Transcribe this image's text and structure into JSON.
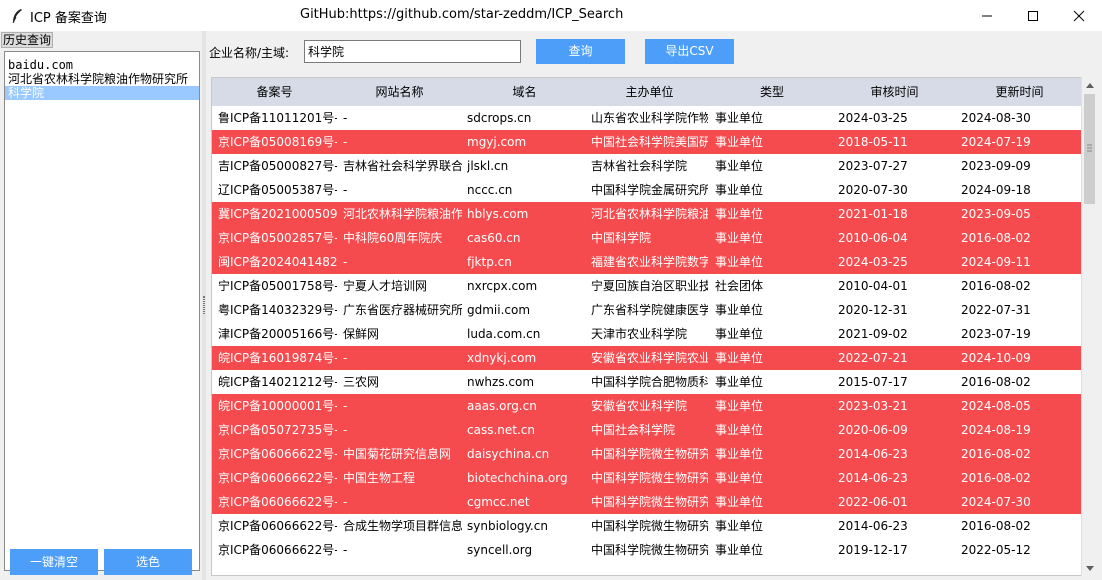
{
  "window": {
    "title": "ICP 备案查询",
    "center_text": "GitHub:https://github.com/star-zeddm/ICP_Search"
  },
  "history": {
    "label": "历史查询",
    "items": [
      "baidu.com",
      "河北省农林科学院粮油作物研究所",
      "科学院"
    ],
    "selected_index": 2,
    "clear_button": "一键清空",
    "color_button": "选色"
  },
  "search": {
    "label": "企业名称/主域:",
    "value": "科学院",
    "query_button": "查询",
    "export_button": "导出CSV"
  },
  "table": {
    "headers": [
      "备案号",
      "网站名称",
      "域名",
      "主办单位",
      "类型",
      "审核时间",
      "更新时间"
    ],
    "rows": [
      {
        "id": "鲁ICP备11011201号-",
        "name": "-",
        "domain": "sdcrops.cn",
        "org": "山东省农业科学院作物",
        "type": "事业单位",
        "audit": "2024-03-25",
        "update": "2024-08-30",
        "highlight": false
      },
      {
        "id": "京ICP备05008169号-",
        "name": "-",
        "domain": "mgyj.com",
        "org": "中国社会科学院美国研",
        "type": "事业单位",
        "audit": "2018-05-11",
        "update": "2024-07-19",
        "highlight": true
      },
      {
        "id": "吉ICP备05000827号-",
        "name": "吉林省社会科学界联合",
        "domain": "jlskl.cn",
        "org": "吉林省社会科学院",
        "type": "事业单位",
        "audit": "2023-07-27",
        "update": "2023-09-09",
        "highlight": false
      },
      {
        "id": "辽ICP备05005387号-",
        "name": "-",
        "domain": "nccc.cn",
        "org": "中国科学院金属研究所",
        "type": "事业单位",
        "audit": "2020-07-30",
        "update": "2024-09-18",
        "highlight": false
      },
      {
        "id": "冀ICP备2021000509号",
        "name": "河北农林科学院粮油作",
        "domain": "hblys.com",
        "org": "河北省农林科学院粮油",
        "type": "事业单位",
        "audit": "2021-01-18",
        "update": "2023-09-05",
        "highlight": true
      },
      {
        "id": "京ICP备05002857号-",
        "name": "中科院60周年院庆",
        "domain": "cas60.cn",
        "org": "中国科学院",
        "type": "事业单位",
        "audit": "2010-06-04",
        "update": "2016-08-02",
        "highlight": true
      },
      {
        "id": "闽ICP备2024041482号",
        "name": "-",
        "domain": "fjktp.cn",
        "org": "福建省农业科学院数字",
        "type": "事业单位",
        "audit": "2024-03-25",
        "update": "2024-09-11",
        "highlight": true
      },
      {
        "id": "宁ICP备05001758号-",
        "name": "宁夏人才培训网",
        "domain": "nxrcpx.com",
        "org": "宁夏回族自治区职业技",
        "type": "社会团体",
        "audit": "2010-04-01",
        "update": "2016-08-02",
        "highlight": false
      },
      {
        "id": "粤ICP备14032329号-",
        "name": "广东省医疗器械研究所",
        "domain": "gdmii.com",
        "org": "广东省科学院健康医学",
        "type": "事业单位",
        "audit": "2020-12-31",
        "update": "2022-07-31",
        "highlight": false
      },
      {
        "id": "津ICP备20005166号-",
        "name": "保鲜网",
        "domain": "luda.com.cn",
        "org": "天津市农业科学院",
        "type": "事业单位",
        "audit": "2021-09-02",
        "update": "2023-07-19",
        "highlight": false
      },
      {
        "id": "皖ICP备16019874号-",
        "name": "-",
        "domain": "xdnykj.com",
        "org": "安徽省农业科学院农业",
        "type": "事业单位",
        "audit": "2022-07-21",
        "update": "2024-10-09",
        "highlight": true
      },
      {
        "id": "皖ICP备14021212号-",
        "name": "三农网",
        "domain": "nwhzs.com",
        "org": "中国科学院合肥物质科",
        "type": "事业单位",
        "audit": "2015-07-17",
        "update": "2016-08-02",
        "highlight": false
      },
      {
        "id": "皖ICP备10000001号-",
        "name": "-",
        "domain": "aaas.org.cn",
        "org": "安徽省农业科学院",
        "type": "事业单位",
        "audit": "2023-03-21",
        "update": "2024-08-05",
        "highlight": true
      },
      {
        "id": "京ICP备05072735号-",
        "name": "-",
        "domain": "cass.net.cn",
        "org": "中国社会科学院",
        "type": "事业单位",
        "audit": "2020-06-09",
        "update": "2024-08-19",
        "highlight": true
      },
      {
        "id": "京ICP备06066622号-",
        "name": "中国菊花研究信息网",
        "domain": "daisychina.cn",
        "org": "中国科学院微生物研究",
        "type": "事业单位",
        "audit": "2014-06-23",
        "update": "2016-08-02",
        "highlight": true
      },
      {
        "id": "京ICP备06066622号-",
        "name": "中国生物工程",
        "domain": "biotechchina.org",
        "org": "中国科学院微生物研究",
        "type": "事业单位",
        "audit": "2014-06-23",
        "update": "2016-08-02",
        "highlight": true
      },
      {
        "id": "京ICP备06066622号-",
        "name": "-",
        "domain": "cgmcc.net",
        "org": "中国科学院微生物研究",
        "type": "事业单位",
        "audit": "2022-06-01",
        "update": "2024-07-30",
        "highlight": true
      },
      {
        "id": "京ICP备06066622号-",
        "name": "合成生物学项目群信息",
        "domain": "synbiology.cn",
        "org": "中国科学院微生物研究",
        "type": "事业单位",
        "audit": "2014-06-23",
        "update": "2016-08-02",
        "highlight": false
      },
      {
        "id": "京ICP备06066622号-",
        "name": "-",
        "domain": "syncell.org",
        "org": "中国科学院微生物研究",
        "type": "事业单位",
        "audit": "2019-12-17",
        "update": "2022-05-12",
        "highlight": false
      }
    ]
  }
}
